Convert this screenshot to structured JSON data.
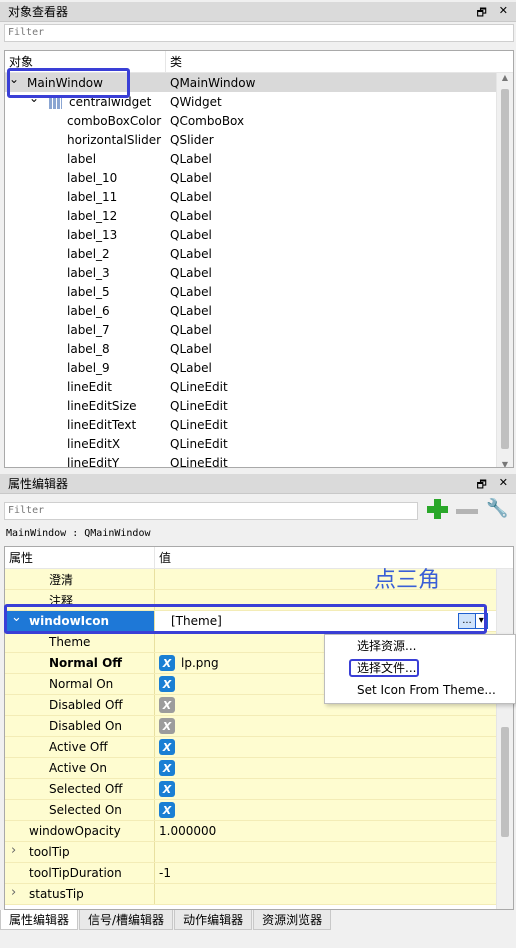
{
  "object_inspector": {
    "title": "对象查看器",
    "filter_placeholder": "Filter",
    "col_object": "对象",
    "col_class": "类",
    "rows": [
      {
        "name": "MainWindow",
        "cls": "QMainWindow"
      },
      {
        "name": "centralwidget",
        "cls": "QWidget"
      },
      {
        "name": "comboBoxColor",
        "cls": "QComboBox"
      },
      {
        "name": "horizontalSlider",
        "cls": "QSlider"
      },
      {
        "name": "label",
        "cls": "QLabel"
      },
      {
        "name": "label_10",
        "cls": "QLabel"
      },
      {
        "name": "label_11",
        "cls": "QLabel"
      },
      {
        "name": "label_12",
        "cls": "QLabel"
      },
      {
        "name": "label_13",
        "cls": "QLabel"
      },
      {
        "name": "label_2",
        "cls": "QLabel"
      },
      {
        "name": "label_3",
        "cls": "QLabel"
      },
      {
        "name": "label_5",
        "cls": "QLabel"
      },
      {
        "name": "label_6",
        "cls": "QLabel"
      },
      {
        "name": "label_7",
        "cls": "QLabel"
      },
      {
        "name": "label_8",
        "cls": "QLabel"
      },
      {
        "name": "label_9",
        "cls": "QLabel"
      },
      {
        "name": "lineEdit",
        "cls": "QLineEdit"
      },
      {
        "name": "lineEditSize",
        "cls": "QLineEdit"
      },
      {
        "name": "lineEditText",
        "cls": "QLineEdit"
      },
      {
        "name": "lineEditX",
        "cls": "QLineEdit"
      },
      {
        "name": "lineEditY",
        "cls": "QLineEdit"
      }
    ]
  },
  "property_editor": {
    "title": "属性编辑器",
    "filter_placeholder": "Filter",
    "context": "MainWindow : QMainWindow",
    "col_property": "属性",
    "col_value": "值",
    "annotation": "点三角",
    "rows": [
      {
        "k": "澄清",
        "v": ""
      },
      {
        "k": "注释",
        "v": ""
      },
      {
        "k": "windowIcon",
        "v": "[Theme]"
      },
      {
        "k": "Theme",
        "v": ""
      },
      {
        "k": "Normal Off",
        "v": "lp.png"
      },
      {
        "k": "Normal On",
        "v": ""
      },
      {
        "k": "Disabled Off",
        "v": ""
      },
      {
        "k": "Disabled On",
        "v": ""
      },
      {
        "k": "Active Off",
        "v": ""
      },
      {
        "k": "Active On",
        "v": ""
      },
      {
        "k": "Selected Off",
        "v": ""
      },
      {
        "k": "Selected On",
        "v": ""
      },
      {
        "k": "windowOpacity",
        "v": "1.000000"
      },
      {
        "k": "toolTip",
        "v": ""
      },
      {
        "k": "toolTipDuration",
        "v": "-1"
      },
      {
        "k": "statusTip",
        "v": ""
      }
    ],
    "dropdown_button_label": "...",
    "popup_items": [
      "选择资源...",
      "选择文件...",
      "Set Icon From Theme..."
    ]
  },
  "tabs": [
    "属性编辑器",
    "信号/槽编辑器",
    "动作编辑器",
    "资源浏览器"
  ],
  "colors": {
    "highlight": "#3a3fd6",
    "selection": "#1e78d7",
    "prop_bg": "#fefcd0"
  }
}
